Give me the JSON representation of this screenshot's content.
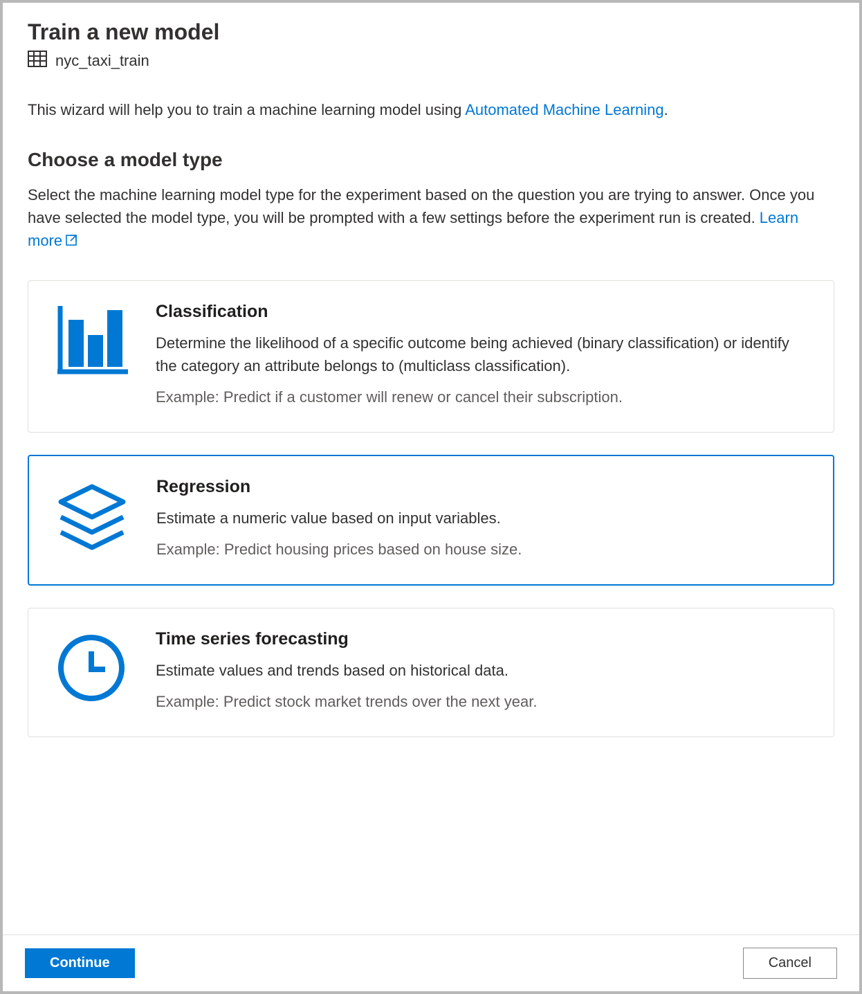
{
  "header": {
    "title": "Train a new model",
    "dataset_name": "nyc_taxi_train"
  },
  "intro": {
    "text_prefix": "This wizard will help you to train a machine learning model using ",
    "link_text": "Automated Machine Learning",
    "text_suffix": "."
  },
  "section": {
    "title": "Choose a model type",
    "desc_prefix": "Select the machine learning model type for the experiment based on the question you are trying to answer. Once you have selected the model type, you will be prompted with a few settings before the experiment run is created. ",
    "learn_more": "Learn more"
  },
  "cards": [
    {
      "id": "classification",
      "title": "Classification",
      "desc": "Determine the likelihood of a specific outcome being achieved (binary classification) or identify the category an attribute belongs to (multiclass classification).",
      "example": "Example: Predict if a customer will renew or cancel their subscription.",
      "selected": false
    },
    {
      "id": "regression",
      "title": "Regression",
      "desc": "Estimate a numeric value based on input variables.",
      "example": "Example: Predict housing prices based on house size.",
      "selected": true
    },
    {
      "id": "timeseries",
      "title": "Time series forecasting",
      "desc": "Estimate values and trends based on historical data.",
      "example": "Example: Predict stock market trends over the next year.",
      "selected": false
    }
  ],
  "footer": {
    "continue_label": "Continue",
    "cancel_label": "Cancel"
  },
  "colors": {
    "accent": "#0078d4"
  }
}
